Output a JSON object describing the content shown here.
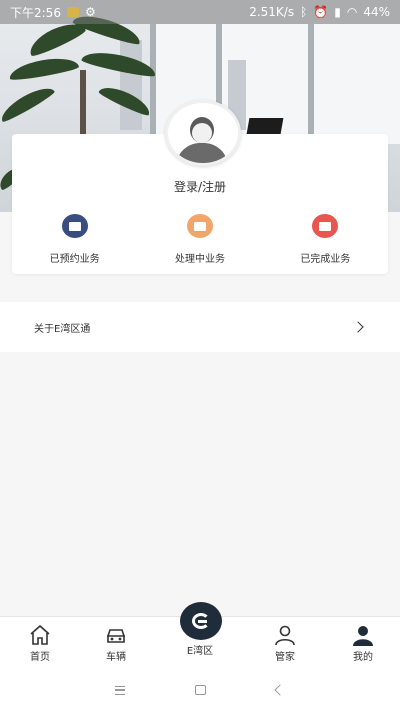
{
  "status_bar": {
    "time": "下午2:56",
    "speed": "2.51K/s",
    "battery": "44%"
  },
  "profile": {
    "login_label": "登录/注册"
  },
  "business": [
    {
      "label": "已预约业务",
      "icon": "calendar-doc-icon",
      "color": "#3a4d80"
    },
    {
      "label": "处理中业务",
      "icon": "processing-doc-icon",
      "color": "#f0a66b"
    },
    {
      "label": "已完成业务",
      "icon": "completed-doc-icon",
      "color": "#e8564f"
    }
  ],
  "about": {
    "label": "关于E湾区通"
  },
  "tabs": [
    {
      "label": "首页",
      "icon": "home-icon"
    },
    {
      "label": "车辆",
      "icon": "car-icon"
    },
    {
      "label": "E湾区",
      "icon": "e-logo-icon"
    },
    {
      "label": "管家",
      "icon": "butler-icon"
    },
    {
      "label": "我的",
      "icon": "user-icon"
    }
  ],
  "colors": {
    "accent_dark": "#1f2c3a",
    "background": "#f6f6f6"
  }
}
